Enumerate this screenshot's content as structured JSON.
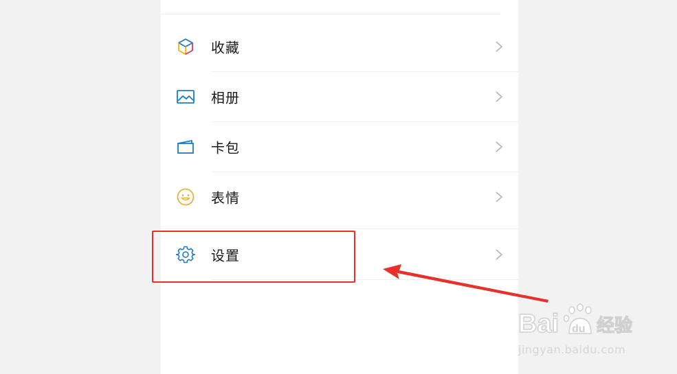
{
  "menu": {
    "items": [
      {
        "label": "收藏",
        "icon": "favorites-cube-icon"
      },
      {
        "label": "相册",
        "icon": "photo-album-icon"
      },
      {
        "label": "卡包",
        "icon": "card-wallet-icon"
      },
      {
        "label": "表情",
        "icon": "sticker-smiley-icon"
      },
      {
        "label": "设置",
        "icon": "settings-gear-icon"
      }
    ]
  },
  "annotation": {
    "highlight_color": "#e8302a",
    "arrow_color": "#e8302a"
  },
  "watermark": {
    "brand": "Baidu经验",
    "url": "jingyan.baidu.com"
  },
  "colors": {
    "background": "#f2f2f2",
    "panel": "#ffffff",
    "icon_blue": "#1d7bc1",
    "icon_yellow": "#e3b23c"
  }
}
